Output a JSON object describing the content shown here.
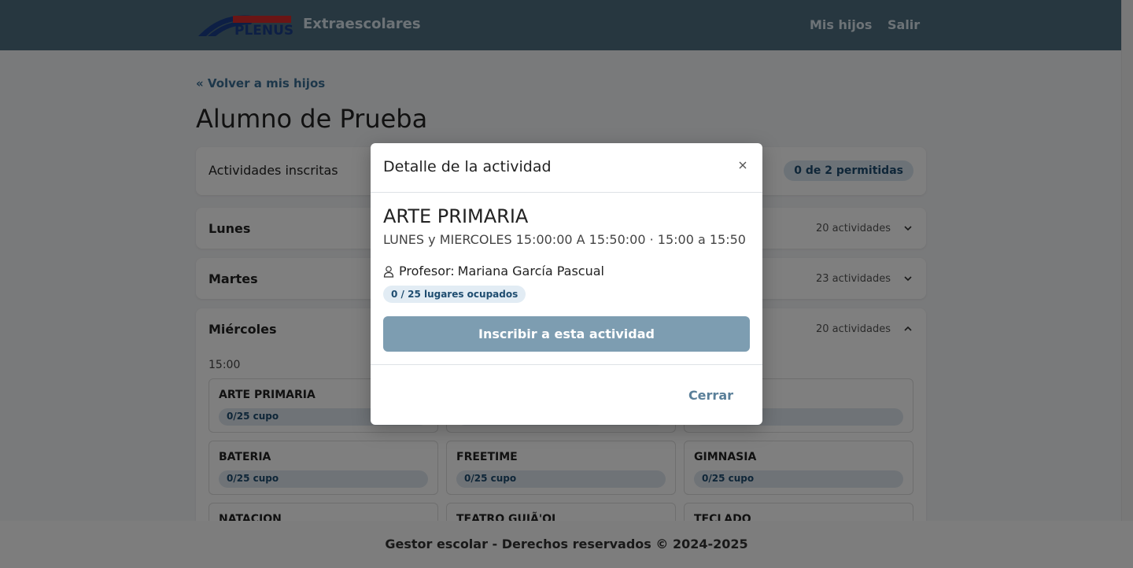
{
  "header": {
    "brand": "Extraescolares",
    "logo_text": "PLENUS",
    "nav": [
      {
        "label": "Mis hijos"
      },
      {
        "label": "Salir"
      }
    ]
  },
  "page": {
    "back_link": "« Volver a mis hijos",
    "title": "Alumno de Prueba"
  },
  "summary": {
    "label": "Actividades inscritas",
    "badge": "0 de 2 permitidas"
  },
  "days": [
    {
      "label": "Lunes",
      "count": "20 actividades",
      "expanded": false
    },
    {
      "label": "Martes",
      "count": "23 actividades",
      "expanded": false
    },
    {
      "label": "Miércoles",
      "count": "20 actividades",
      "expanded": true
    }
  ],
  "wednesday": {
    "hour": "15:00",
    "activities": [
      {
        "name": "ARTE PRIMARIA",
        "cupo": "0/25 cupo"
      },
      {
        "name": "",
        "cupo": ""
      },
      {
        "name": "",
        "cupo": ""
      },
      {
        "name": "BATERIA",
        "cupo": "0/25 cupo"
      },
      {
        "name": "FREETIME",
        "cupo": "0/25 cupo"
      },
      {
        "name": "GIMNASIA",
        "cupo": "0/25 cupo"
      },
      {
        "name": "NATACION",
        "cupo": ""
      },
      {
        "name": "TEATRO GUIÃ'OL",
        "cupo": ""
      },
      {
        "name": "TECLADO",
        "cupo": ""
      }
    ]
  },
  "footer": {
    "text": "Gestor escolar - Derechos reservados © 2024-2025"
  },
  "modal": {
    "title": "Detalle de la actividad",
    "activity_name": "ARTE PRIMARIA",
    "schedule": "LUNES y MIERCOLES 15:00:00 A 15:50:00 · 15:00 a 15:50",
    "teacher_label": "Profesor:",
    "teacher_name": "Mariana García Pascual",
    "places": "0 / 25 lugares ocupados",
    "enroll_button": "Inscribir a esta actividad",
    "close_button": "Cerrar"
  },
  "colors": {
    "header_bg": "#4f6e80",
    "accent": "#3b6f95",
    "badge_bg": "#d9e5ef",
    "enroll_button_bg": "#7d9db1"
  }
}
